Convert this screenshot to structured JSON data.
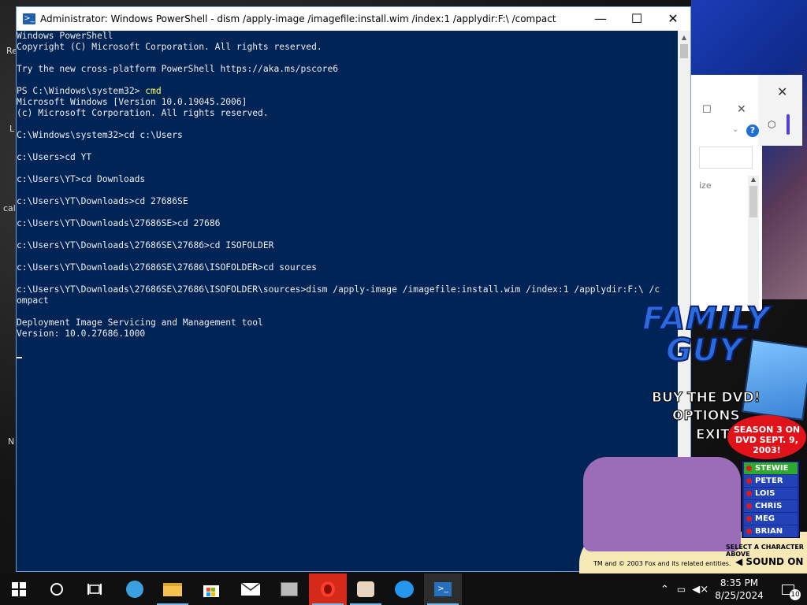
{
  "window": {
    "title": "Administrator: Windows PowerShell - dism  /apply-image /imagefile:install.wim /index:1 /applydir:F:\\ /compact",
    "minimize": "—",
    "maximize": "☐",
    "close": "✕"
  },
  "console": {
    "lines": [
      "Windows PowerShell",
      "Copyright (C) Microsoft Corporation. All rights reserved.",
      "",
      "Try the new cross-platform PowerShell https://aka.ms/pscore6",
      "",
      "PS C:\\Windows\\system32> ",
      "Microsoft Windows [Version 10.0.19045.2006]",
      "(c) Microsoft Corporation. All rights reserved.",
      "",
      "C:\\Windows\\system32>cd c:\\Users",
      "",
      "c:\\Users>cd YT",
      "",
      "c:\\Users\\YT>cd Downloads",
      "",
      "c:\\Users\\YT\\Downloads>cd 27686SE",
      "",
      "c:\\Users\\YT\\Downloads\\27686SE>cd 27686",
      "",
      "c:\\Users\\YT\\Downloads\\27686SE\\27686>cd ISOFOLDER",
      "",
      "c:\\Users\\YT\\Downloads\\27686SE\\27686\\ISOFOLDER>cd sources",
      "",
      "c:\\Users\\YT\\Downloads\\27686SE\\27686\\ISOFOLDER\\sources>dism /apply-image /imagefile:install.wim /index:1 /applydir:F:\\ /c",
      "ompact",
      "",
      "Deployment Image Servicing and Management tool",
      "Version: 10.0.27686.1000"
    ],
    "ps_command": "cmd"
  },
  "desktop": {
    "labels": [
      "Re",
      "L",
      "cal",
      "N"
    ]
  },
  "background_window": {
    "column_label": "ize"
  },
  "family_guy": {
    "logo_line1": "FAMILY",
    "logo_line2": "GUY",
    "menu": [
      "BUY THE DVD!",
      "OPTIONS",
      "EXIT"
    ],
    "badge": "SEASON 3 ON DVD SEPT. 9, 2003!",
    "characters": [
      "STEWIE",
      "PETER",
      "LOIS",
      "CHRIS",
      "MEG",
      "BRIAN"
    ],
    "select_hint": "SELECT A CHARACTER ABOVE",
    "copyright": "TM and © 2003 Fox and its related entities.",
    "sound": "SOUND ON"
  },
  "taskbar": {
    "icons": [
      "windows-start-icon",
      "cortana-search-icon",
      "task-view-icon",
      "browser-icon",
      "file-explorer-icon",
      "microsoft-store-icon",
      "mail-icon",
      "app-icon",
      "opera-icon",
      "family-guy-app-icon",
      "docker-icon",
      "powershell-icon"
    ],
    "time": "8:35 PM",
    "date": "8/25/2024",
    "notification_count": "10"
  }
}
